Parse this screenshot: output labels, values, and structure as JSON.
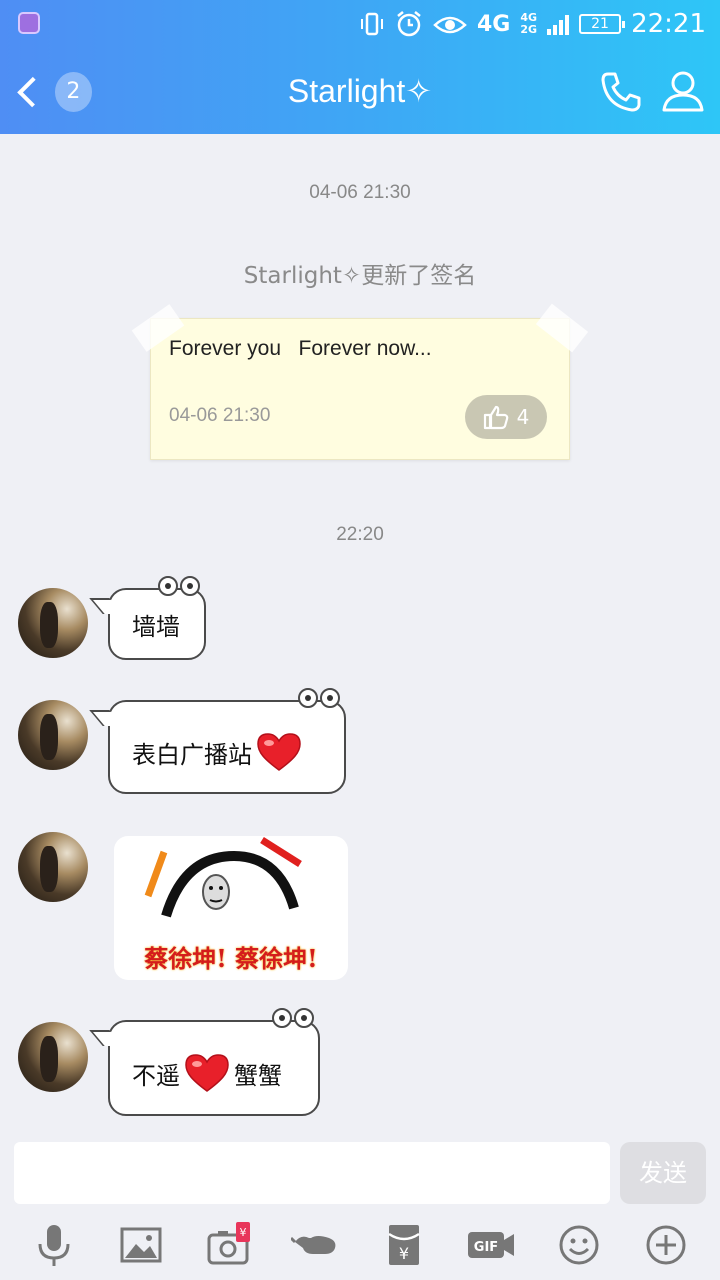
{
  "status": {
    "battery": "21",
    "time": "22:21",
    "net": "4G",
    "net_small_top": "4G",
    "net_small_bottom": "2G"
  },
  "header": {
    "title": "Starlight✧",
    "back_badge": "2"
  },
  "chat": {
    "time1": "04-06 21:30",
    "system_msg": "Starlight✧更新了签名",
    "signature": {
      "text": "Forever you   Forever now...",
      "time": "04-06 21:30",
      "likes": "4"
    },
    "time2": "22:20",
    "messages": [
      {
        "text": "墙墙"
      },
      {
        "text": "表白广播站"
      },
      {
        "sticker_caption": "蔡徐坤! 蔡徐坤!"
      },
      {
        "text_a": "不遥",
        "text_b": "蟹蟹"
      }
    ]
  },
  "input": {
    "send_label": "发送",
    "value": ""
  },
  "toolbar": [
    "mic-icon",
    "image-icon",
    "camera-redpacket-icon",
    "poke-icon",
    "redpacket-icon",
    "gif-icon",
    "emoji-icon",
    "plus-icon"
  ],
  "colors": {
    "header_start": "#4f8ef4",
    "header_end": "#2ec6f7",
    "background": "#eff0f5",
    "note_bg": "#fffde0",
    "heart": "#e8202a"
  }
}
